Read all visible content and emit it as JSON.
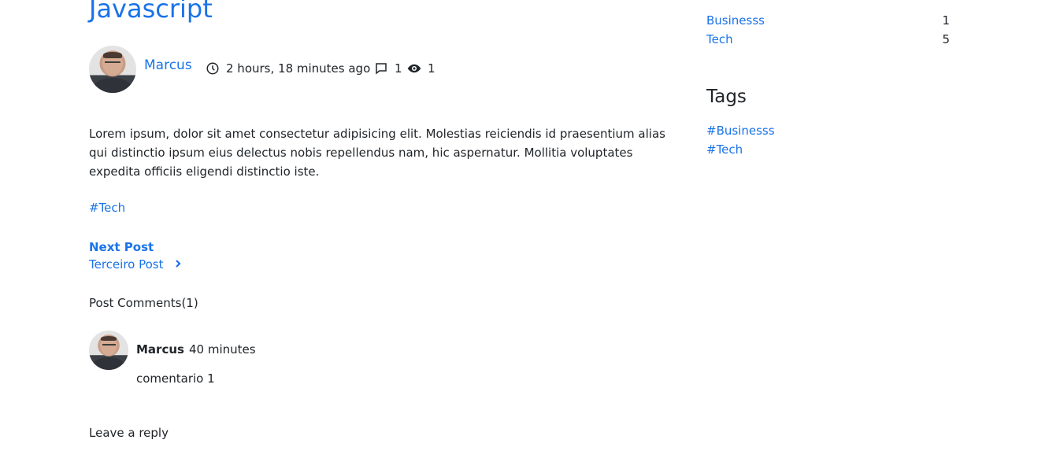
{
  "post": {
    "title": "Javascript",
    "author": "Marcus",
    "time_ago": "2 hours, 18 minutes ago",
    "comment_count": "1",
    "view_count": "1",
    "excerpt": "Lorem ipsum, dolor sit amet consectetur adipisicing elit. Molestias reiciendis id praesentium alias qui distinctio ipsum eius delectus nobis repellendus nam, hic aspernatur. Mollitia voluptates expedita officiis eligendi distinctio iste.",
    "tag": "#Tech"
  },
  "next_post": {
    "label": "Next Post",
    "title": "Terceiro Post"
  },
  "comments": {
    "heading": "Post Comments(1)",
    "items": [
      {
        "author": "Marcus",
        "time": "40 minutes",
        "body": "comentario 1"
      }
    ]
  },
  "reply": {
    "heading": "Leave a reply"
  },
  "sidebar": {
    "categories": [
      {
        "name": "Businesss",
        "count": "1"
      },
      {
        "name": "Tech",
        "count": "5"
      }
    ],
    "tags_heading": "Tags",
    "tags": [
      "#Businesss",
      "#Tech"
    ]
  },
  "icons": {
    "time": "clock-icon",
    "comments": "comment-icon",
    "views": "eye-icon",
    "next": "chevron-right-icon"
  },
  "colors": {
    "link": "#1a73e8",
    "text": "#212529"
  }
}
